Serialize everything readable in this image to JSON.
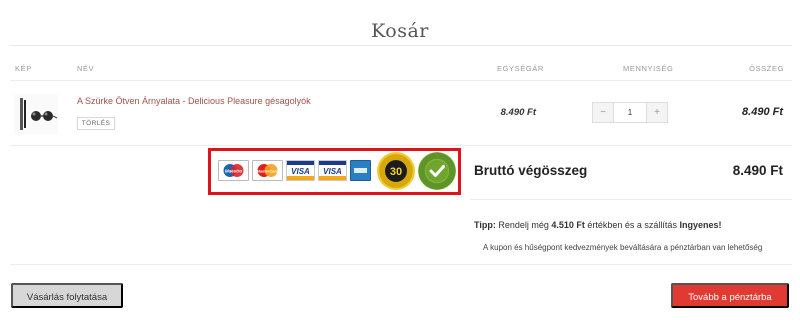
{
  "page": {
    "title": "Kosár"
  },
  "table": {
    "headers": {
      "image": "KÉP",
      "name": "NÉV",
      "unit_price": "EGYSÉGÁR",
      "quantity": "MENNYISÉG",
      "total": "ÖSSZEG"
    }
  },
  "cart_item": {
    "name": "A Szürke Ötven Árnyalata - Delicious Pleasure gésagolyók",
    "remove_label": "TÖRLÉS",
    "unit_price": "8.490 Ft",
    "quantity": "1",
    "minus_label": "−",
    "plus_label": "+",
    "line_total": "8.490 Ft"
  },
  "payment_badges": {
    "maestro": "Maestro",
    "mastercard": "MasterCard",
    "visa": "VISA",
    "visa_electron": "VISA",
    "guarantee_number": "30",
    "colors": {
      "highlight_border": "#e0131a"
    }
  },
  "summary": {
    "gross_label": "Bruttó végösszeg",
    "gross_total": "8.490 Ft"
  },
  "tip": {
    "label": "Tipp:",
    "text_before": " Rendelj még ",
    "amount": "4.510 Ft",
    "text_after": " értékben és a szállítás ",
    "free": "Ingyenes!"
  },
  "coupon_note": "A kupon és hűségpont kedvezmények beváltására a pénztárban van lehetőség",
  "buttons": {
    "continue": "Vásárlás folytatása",
    "checkout": "Tovább a pénztárba",
    "colors": {
      "checkout": "#e03a33",
      "continue": "#d7d7d7"
    }
  }
}
